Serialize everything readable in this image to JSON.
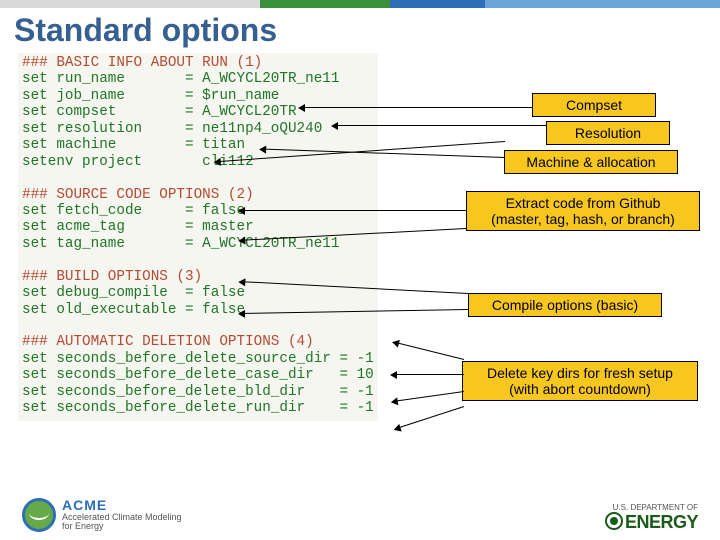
{
  "title": "Standard options",
  "code_lines": [
    {
      "t": "### BASIC INFO ABOUT RUN (1)",
      "cls": "s1"
    },
    {
      "t": "set run_name       = A_WCYCL20TR_ne11",
      "cls": "s2"
    },
    {
      "t": "set job_name       = $run_name",
      "cls": "s2"
    },
    {
      "t": "set compset        = A_WCYCL20TR",
      "cls": "s2"
    },
    {
      "t": "set resolution     = ne11np4_oQU240",
      "cls": "s2"
    },
    {
      "t": "set machine        = titan",
      "cls": "s2"
    },
    {
      "t": "setenv project       cli112",
      "cls": "s2"
    },
    {
      "t": "",
      "cls": ""
    },
    {
      "t": "### SOURCE CODE OPTIONS (2)",
      "cls": "s1"
    },
    {
      "t": "set fetch_code     = false",
      "cls": "s2"
    },
    {
      "t": "set acme_tag       = master",
      "cls": "s2"
    },
    {
      "t": "set tag_name       = A_WCYCL20TR_ne11",
      "cls": "s2"
    },
    {
      "t": "",
      "cls": ""
    },
    {
      "t": "### BUILD OPTIONS (3)",
      "cls": "s1"
    },
    {
      "t": "set debug_compile  = false",
      "cls": "s2"
    },
    {
      "t": "set old_executable = false",
      "cls": "s2"
    },
    {
      "t": "",
      "cls": ""
    },
    {
      "t": "### AUTOMATIC DELETION OPTIONS (4)",
      "cls": "s1"
    },
    {
      "t": "set seconds_before_delete_source_dir = -1",
      "cls": "s2"
    },
    {
      "t": "set seconds_before_delete_case_dir   = 10",
      "cls": "s2"
    },
    {
      "t": "set seconds_before_delete_bld_dir    = -1",
      "cls": "s2"
    },
    {
      "t": "set seconds_before_delete_run_dir    = -1",
      "cls": "s2"
    }
  ],
  "callouts": {
    "compset": "Compset",
    "resolution": "Resolution",
    "machine": "Machine & allocation",
    "source": "Extract code from Github\n(master, tag, hash, or branch)",
    "build": "Compile options (basic)",
    "delete": "Delete key dirs for fresh setup\n(with abort countdown)"
  },
  "footer": {
    "acme_name": "ACME",
    "acme_sub": "Accelerated Climate Modeling\nfor Energy",
    "doe_top": "U.S. DEPARTMENT OF",
    "doe_name": "ENERGY"
  }
}
